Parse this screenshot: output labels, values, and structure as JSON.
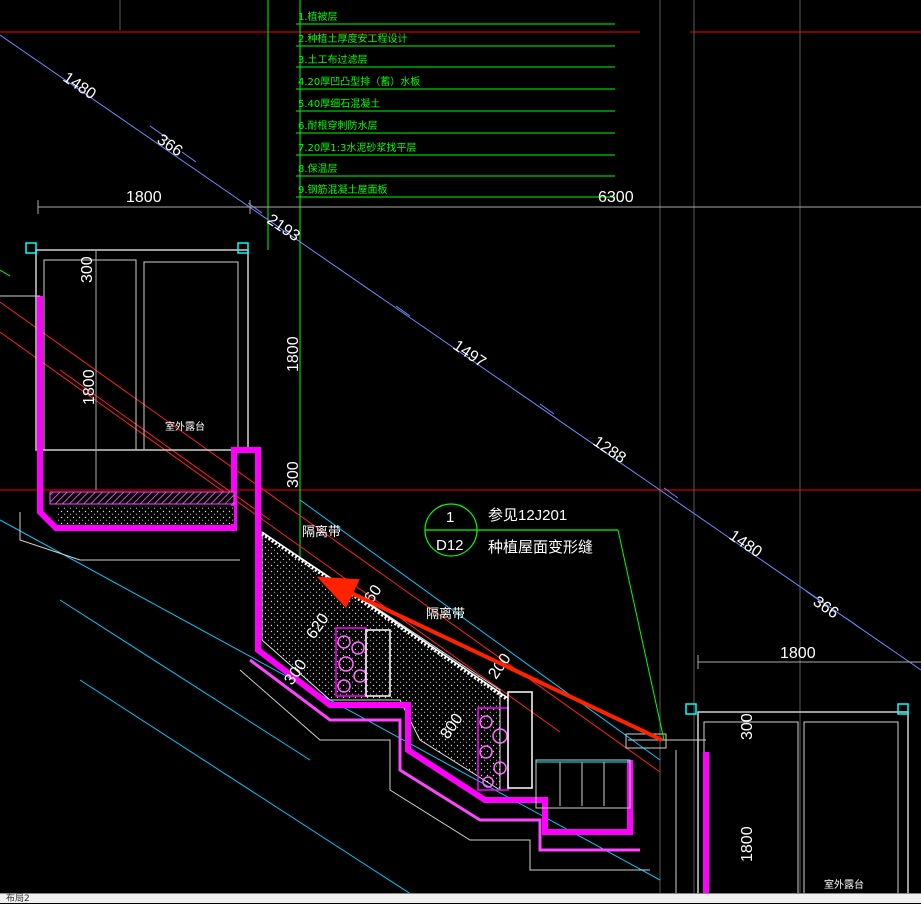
{
  "drawing": {
    "layers": [
      "1.植被层",
      "2.种植土厚度安工程设计",
      "3.土工布过滤层",
      "4.20厚凹凸型排（蓄）水板",
      "5.40厚细石混凝土",
      "6.耐根穿刺防水层",
      "7.20厚1:3水泥砂浆找平层",
      "8.保温层",
      "9.钢筋混凝土屋面板"
    ],
    "dims": {
      "d1480_top": "1480",
      "d366_top": "366",
      "d1800_left": "1800",
      "d6300": "6300",
      "d2193": "2193",
      "d300_left": "300",
      "d1800_vert_left": "1800",
      "d1800_vert_mid": "1800",
      "d300_mid": "300",
      "d1497": "1497",
      "d1288": "1288",
      "d1480_right": "1480",
      "d366_right": "366",
      "d1800_right": "1800",
      "d300_right": "300",
      "d1800_vert_right": "1800",
      "d620": "620",
      "d300_low": "300",
      "d60": "60",
      "d200": "200",
      "d800": "800"
    },
    "labels": {
      "terrace_left": "室外露台",
      "terrace_right": "室外露台",
      "isolation_1": "隔离带",
      "isolation_2": "隔离带"
    },
    "callout": {
      "top_num": "1",
      "bottom_ref": "D12",
      "see": "参见12J201",
      "desc": "种植屋面变形缝"
    },
    "statusbar": "布局2"
  },
  "colors": {
    "background": "#000000",
    "wall": "#ff00ff",
    "layer_text": "#00ff00",
    "axis": "#ff0000",
    "cyan": "#00ffff",
    "arrow": "#ff2200"
  }
}
